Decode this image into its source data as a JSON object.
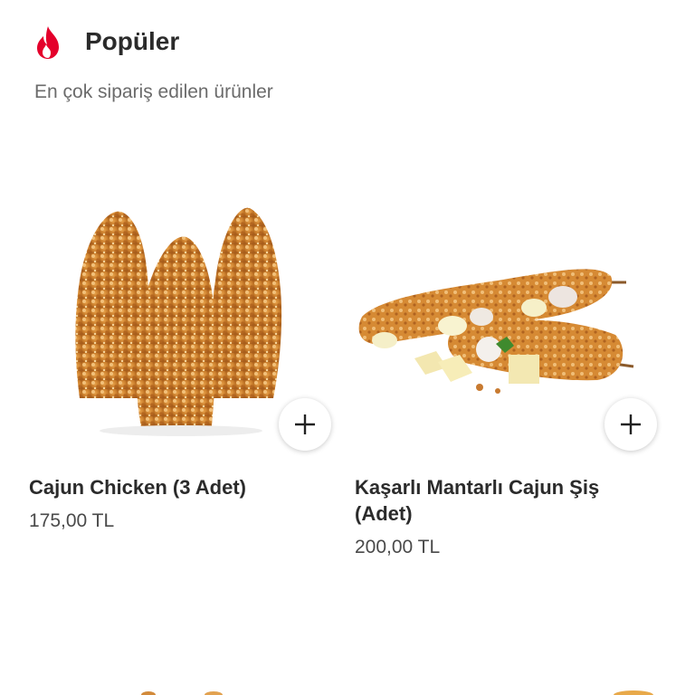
{
  "section": {
    "title": "Popüler",
    "subtitle": "En çok sipariş edilen ürünler",
    "icon": "flame-icon",
    "accent_color": "#E4002B"
  },
  "products": [
    {
      "name": "Cajun Chicken (3 Adet)",
      "price": "175,00 TL",
      "image": "cajun-chicken-image",
      "add_icon": "plus-icon"
    },
    {
      "name": "Kaşarlı Mantarlı Cajun Şiş (Adet)",
      "price": "200,00 TL",
      "image": "cajun-skewer-image",
      "add_icon": "plus-icon"
    }
  ]
}
